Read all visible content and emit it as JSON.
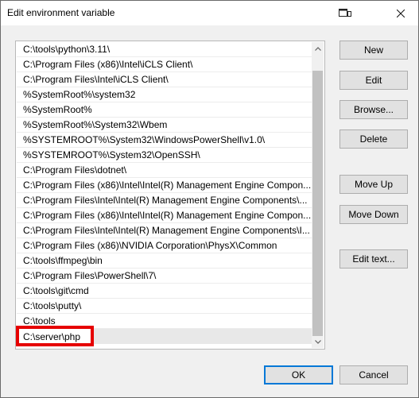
{
  "window": {
    "title": "Edit environment variable"
  },
  "paths": [
    "C:\\tools\\python\\3.11\\",
    "C:\\Program Files (x86)\\Intel\\iCLS Client\\",
    "C:\\Program Files\\Intel\\iCLS Client\\",
    "%SystemRoot%\\system32",
    "%SystemRoot%",
    "%SystemRoot%\\System32\\Wbem",
    "%SYSTEMROOT%\\System32\\WindowsPowerShell\\v1.0\\",
    "%SYSTEMROOT%\\System32\\OpenSSH\\",
    "C:\\Program Files\\dotnet\\",
    "C:\\Program Files (x86)\\Intel\\Intel(R) Management Engine Compon...",
    "C:\\Program Files\\Intel\\Intel(R) Management Engine Components\\...",
    "C:\\Program Files (x86)\\Intel\\Intel(R) Management Engine Compon...",
    "C:\\Program Files\\Intel\\Intel(R) Management Engine Components\\I...",
    "C:\\Program Files (x86)\\NVIDIA Corporation\\PhysX\\Common",
    "C:\\tools\\ffmpeg\\bin",
    "C:\\Program Files\\PowerShell\\7\\",
    "C:\\tools\\git\\cmd",
    "C:\\tools\\putty\\",
    "C:\\tools"
  ],
  "editing_entry": "C:\\server\\php",
  "buttons": {
    "new": "New",
    "edit": "Edit",
    "browse": "Browse...",
    "delete": "Delete",
    "move_up": "Move Up",
    "move_down": "Move Down",
    "edit_text": "Edit text...",
    "ok": "OK",
    "cancel": "Cancel"
  },
  "icons": {
    "title": "window-restore-icon",
    "close": "close-icon",
    "scroll_up": "scroll-up-arrow-icon",
    "scroll_down": "scroll-down-arrow-icon"
  },
  "colors": {
    "highlight_border": "#e60000",
    "default_button_border": "#0078d7"
  }
}
